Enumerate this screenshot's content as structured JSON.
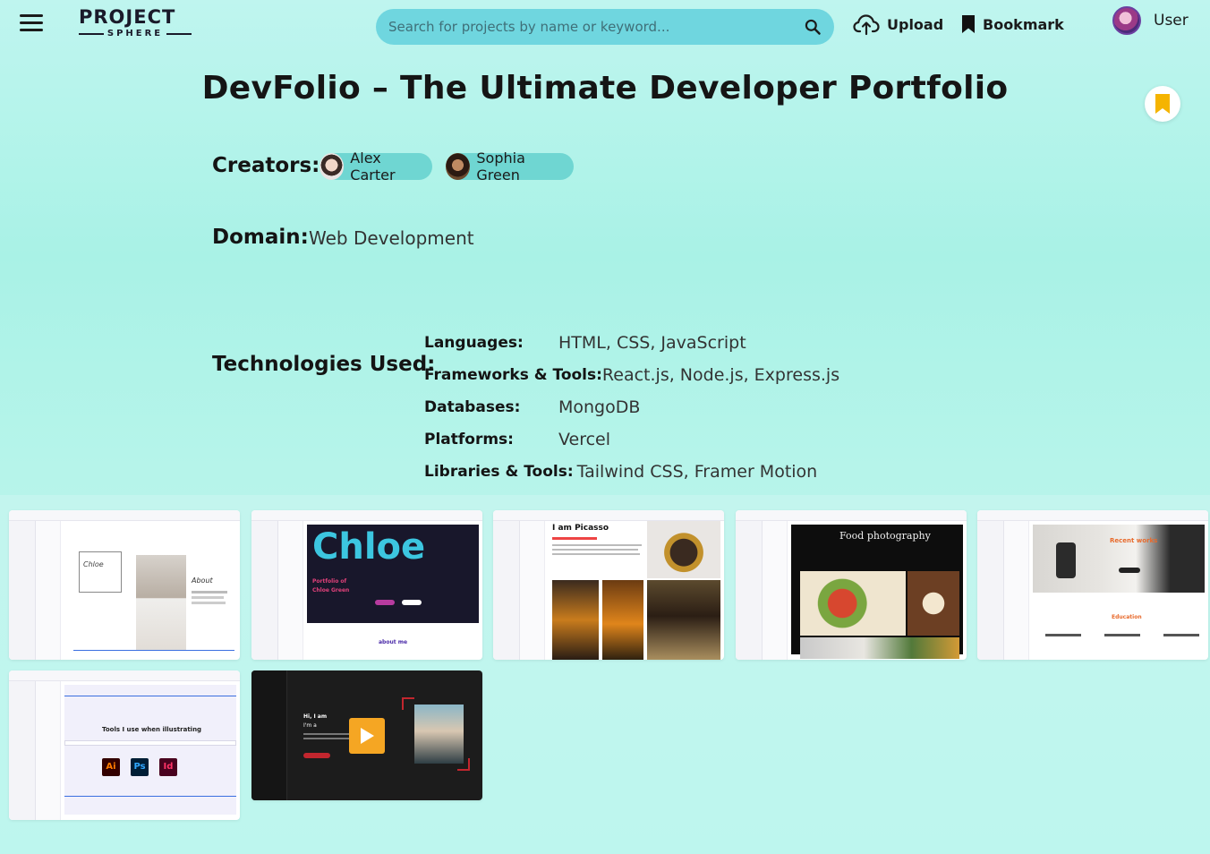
{
  "header": {
    "logo_main": "PROJECT",
    "logo_sub": "SPHERE",
    "search_placeholder": "Search for projects by name or keyword...",
    "upload_label": "Upload",
    "bookmark_label": "Bookmark",
    "user_label": "User"
  },
  "project": {
    "title": "DevFolio – The Ultimate Developer Portfolio",
    "creators_label": "Creators:",
    "creators": [
      {
        "name": "Alex Carter"
      },
      {
        "name": "Sophia Green"
      }
    ],
    "domain_label": "Domain:",
    "domain": "Web Development",
    "technologies_label": "Technologies Used:",
    "technologies": [
      {
        "key": "Languages:",
        "value": "HTML, CSS, JavaScript"
      },
      {
        "key": "Frameworks & Tools:",
        "value": "React.js, Node.js, Express.js"
      },
      {
        "key": "Databases:",
        "value": "MongoDB"
      },
      {
        "key": "Platforms:",
        "value": "Vercel"
      },
      {
        "key": "Libraries & Tools:",
        "value": "Tailwind CSS, Framer Motion"
      }
    ]
  },
  "gallery": {
    "thumbs": [
      {
        "text_a": "Chloe",
        "text_b": "About"
      },
      {
        "text_a": "Chloe",
        "text_b": "Portfolio of",
        "text_c": "Chloe Green",
        "text_d": "about me"
      },
      {
        "text_a": "I am Picasso"
      },
      {
        "text_a": "Food photography"
      },
      {
        "text_a": "Recent works",
        "text_b": "Education"
      },
      {
        "text_a": "Tools I use when illustrating",
        "icons": [
          "Ai",
          "Ps",
          "Id"
        ]
      },
      {
        "text_a": "Hi, I am",
        "text_b": "I'm a"
      }
    ]
  },
  "colors": {
    "accent": "#6fd6df",
    "chip": "#6fd6d2",
    "bookmark_yellow": "#f5b400",
    "play_orange": "#f5a623"
  },
  "icons": {
    "menu": "hamburger-icon",
    "search": "search-icon",
    "upload": "cloud-upload-icon",
    "bookmark": "bookmark-icon",
    "play": "play-icon"
  }
}
